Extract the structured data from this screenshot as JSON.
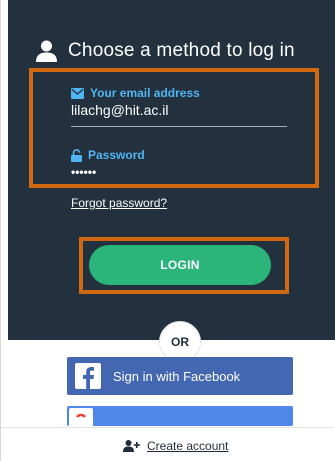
{
  "header": {
    "title": "Choose a method to log in"
  },
  "form": {
    "email_label": "Your email address",
    "email_value": "lilachg@hit.ac.il",
    "password_label": "Password",
    "password_value": "••••••",
    "forgot_link": "Forgot password?",
    "login_label": "LOGIN"
  },
  "divider": {
    "or_label": "OR"
  },
  "social": {
    "facebook_label": "Sign in with Facebook"
  },
  "footer": {
    "create_account_label": "Create account"
  },
  "colors": {
    "panel_bg": "#23303d",
    "label_blue": "#51b5f2",
    "login_green": "#2cb57a",
    "highlight_orange": "#d1670e",
    "facebook_blue": "#4367b0",
    "google_blue": "#4e86ea"
  },
  "icons": [
    "user-icon",
    "envelope-icon",
    "lock-icon",
    "facebook-icon",
    "google-icon",
    "add-user-icon"
  ]
}
